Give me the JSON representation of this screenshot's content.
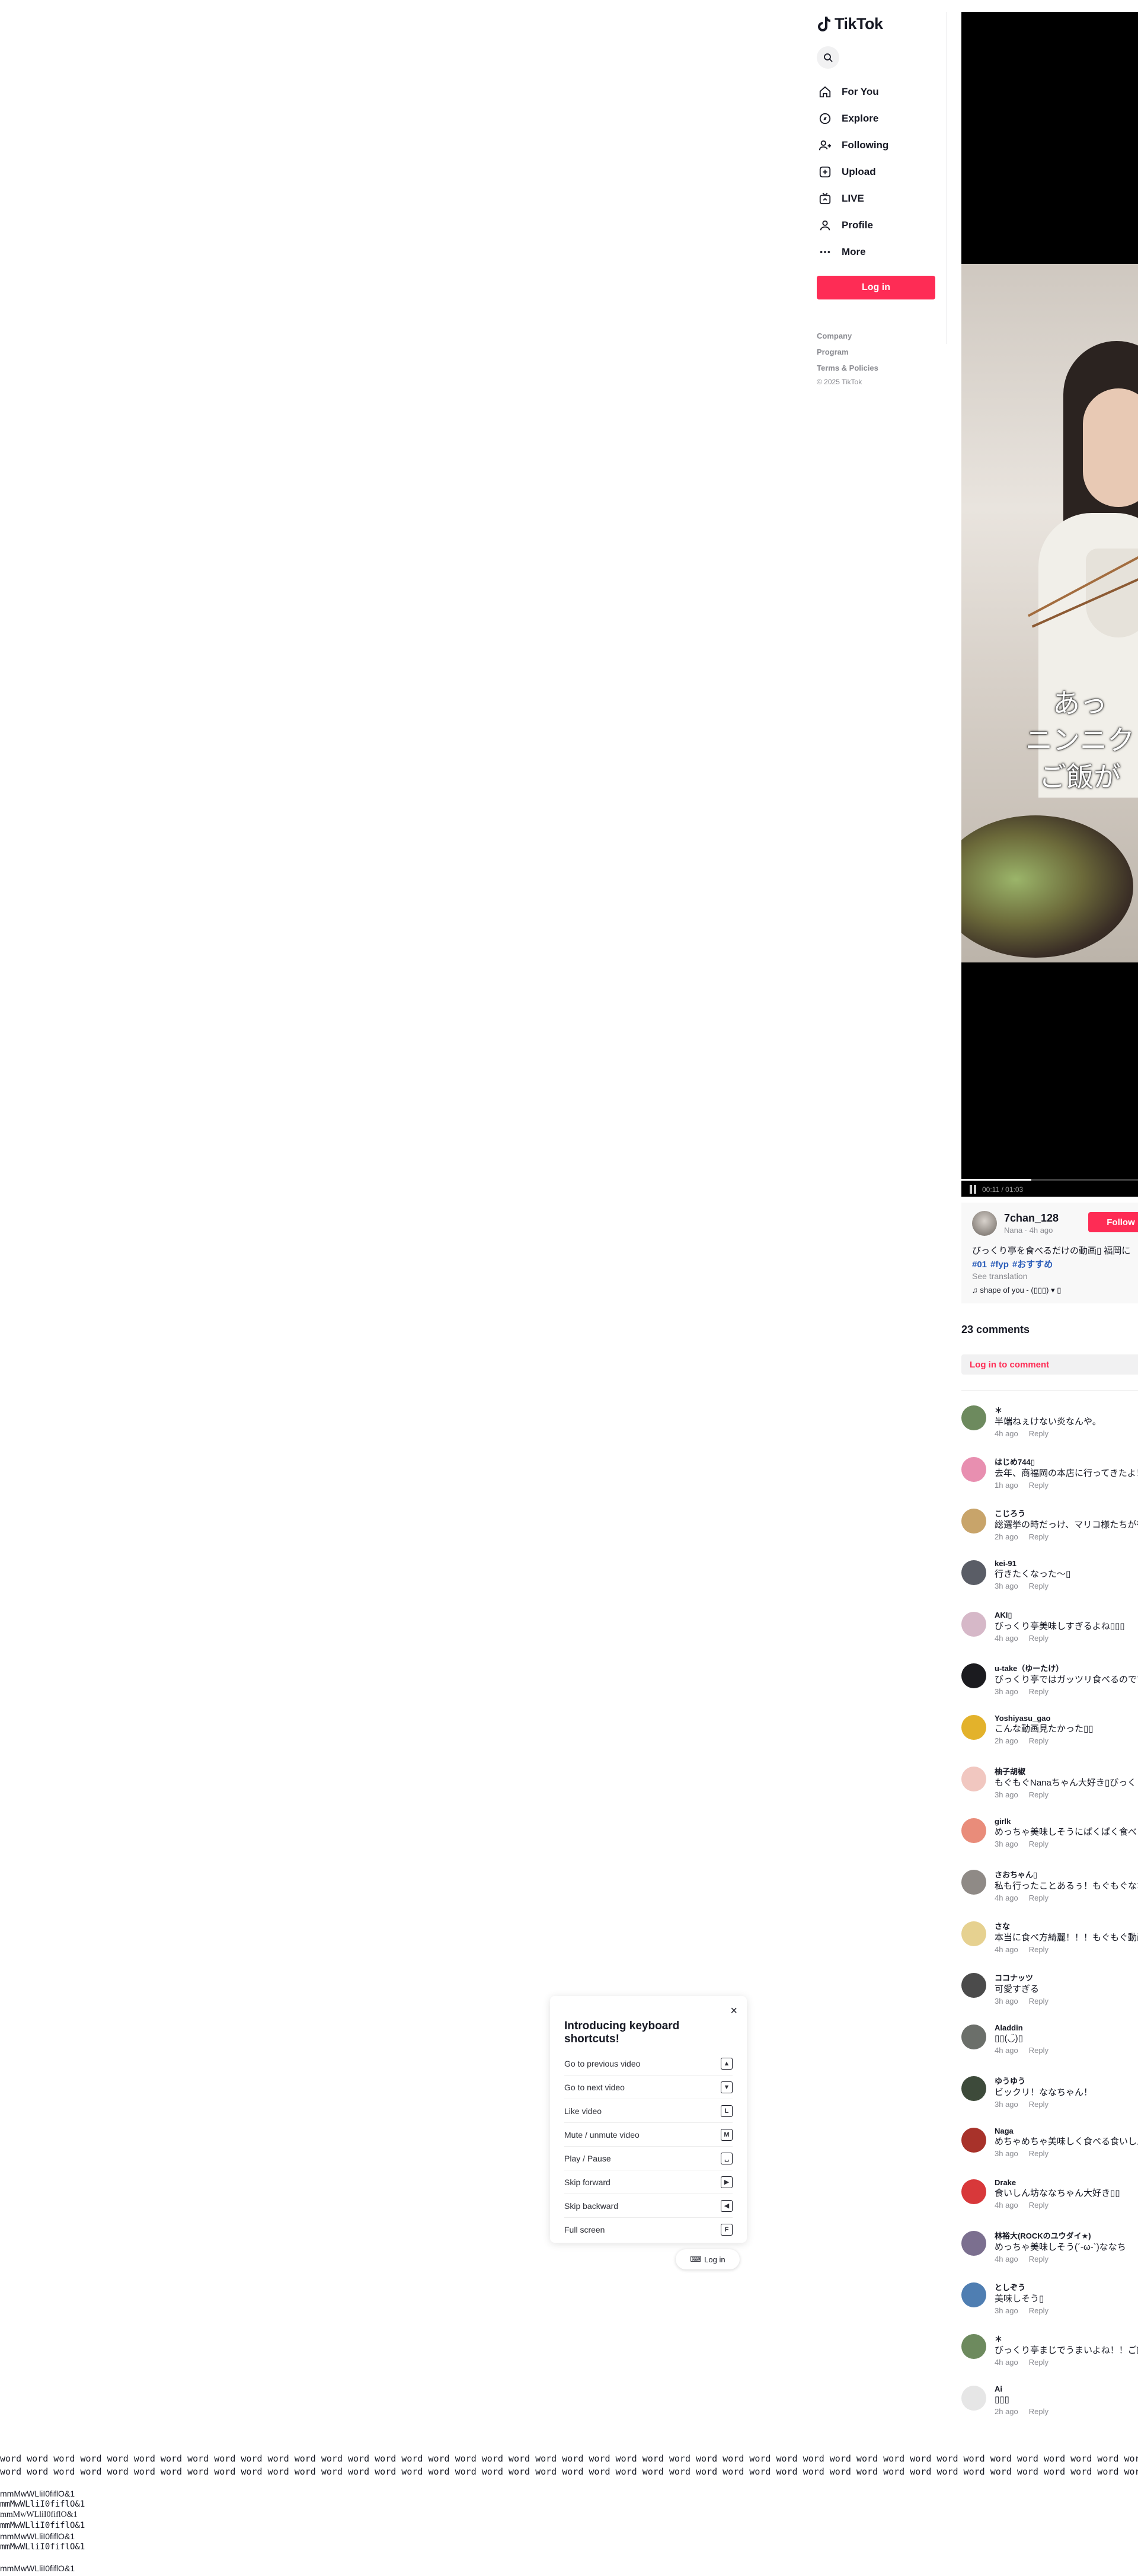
{
  "app": {
    "name": "TikTok"
  },
  "sidebar": {
    "items": [
      {
        "label": "For You",
        "icon": "home-icon"
      },
      {
        "label": "Explore",
        "icon": "compass-icon"
      },
      {
        "label": "Following",
        "icon": "following-icon"
      },
      {
        "label": "Upload",
        "icon": "upload-icon"
      },
      {
        "label": "LIVE",
        "icon": "live-icon"
      },
      {
        "label": "Profile",
        "icon": "profile-icon"
      },
      {
        "label": "More",
        "icon": "more-icon"
      }
    ],
    "login_label": "Log in",
    "footer": [
      "Company",
      "Program",
      "Terms & Policies"
    ],
    "copyright": "© 2025 TikTok"
  },
  "video": {
    "subtitle": [
      "あっ",
      "ニンニク",
      "ご飯が"
    ],
    "time": "00:11 / 01:03",
    "progress": 0.38
  },
  "post": {
    "username": "7chan_128",
    "meta": "Nana · 4h ago",
    "follow_label": "Follow",
    "description": "びっくり亭を食べるだけの動画▯ 福岡に",
    "tags": [
      "#01",
      "#fyp",
      "#おすすめ"
    ],
    "see_translation": "See translation",
    "music": "♫ shape of you - (▯▯▯) ▾ ▯"
  },
  "comments_header": {
    "count_label": "23 comments",
    "login_prompt": "Log in to comment"
  },
  "comments": [
    {
      "user": "＊",
      "text": "半端ねぇけない炎なんや。",
      "time": "4h ago",
      "reply": "Reply",
      "color": "#6d8a5e"
    },
    {
      "user": "はじめ744▯",
      "text": "去年、商福岡の本店に行ってきたよ！",
      "time": "1h ago",
      "reply": "Reply",
      "color": "#e88fb0"
    },
    {
      "user": "こじろう",
      "text": "総選挙の時だっけ、マリコ様たちが行っ",
      "time": "2h ago",
      "reply": "Reply",
      "color": "#c8a46a"
    },
    {
      "user": "kei-91",
      "text": "行きたくなった〜▯",
      "time": "3h ago",
      "reply": "Reply",
      "color": "#5a5d66"
    },
    {
      "user": "AKI▯",
      "text": "びっくり亭美味しすぎるよね▯▯▯",
      "time": "4h ago",
      "reply": "Reply",
      "color": "#d6b8c8"
    },
    {
      "user": "u-take（ゆーたけ）",
      "text": "びっくり亭ではガッツリ食べるのですね",
      "time": "3h ago",
      "reply": "Reply",
      "color": "#1b1b1f"
    },
    {
      "user": "Yoshiyasu_gao",
      "text": "こんな動画見たかった▯▯",
      "time": "2h ago",
      "reply": "Reply",
      "color": "#e3b22b"
    },
    {
      "user": "柚子胡椒",
      "text": "もぐもぐNanaちゃん大好き▯びっくり亭",
      "time": "3h ago",
      "reply": "Reply",
      "color": "#f1c7c0"
    },
    {
      "user": "girlk",
      "text": "めっちゃ美味しそうにぱくぱく食べとる",
      "time": "3h ago",
      "reply": "Reply",
      "color": "#e98c7a"
    },
    {
      "user": "さおちゃん▯",
      "text": "私も行ったことあるぅ！もぐもぐなな",
      "time": "4h ago",
      "reply": "Reply",
      "color": "#8f8a86"
    },
    {
      "user": "さな",
      "text": "本当に食べ方綺麗！！！もぐもぐ動画",
      "time": "4h ago",
      "reply": "Reply",
      "color": "#e6d190"
    },
    {
      "user": "ココナッツ",
      "text": "可愛すぎる",
      "time": "3h ago",
      "reply": "Reply",
      "color": "#4b4b4b"
    },
    {
      "user": "Aladdin",
      "text": "▯▯(◡̈)▯",
      "time": "4h ago",
      "reply": "Reply",
      "color": "#6b6f6a"
    },
    {
      "user": "ゆうゆう",
      "text": "ビックリ！ななちゃん！",
      "time": "3h ago",
      "reply": "Reply",
      "color": "#3d4a3a"
    },
    {
      "user": "Naga",
      "text": "めちゃめちゃ美味しく食べる食いしん坊",
      "time": "3h ago",
      "reply": "Reply",
      "color": "#a8322a"
    },
    {
      "user": "Drake",
      "text": "食いしん坊ななちゃん大好き▯▯",
      "time": "4h ago",
      "reply": "Reply",
      "color": "#d8383a"
    },
    {
      "user": "林裕大(ROCKのユウダイ★)",
      "text": "めっちゃ美味しそう(´-ω-`)ななち",
      "time": "4h ago",
      "reply": "Reply",
      "color": "#7b6f8f"
    },
    {
      "user": "としぞう",
      "text": "美味しそう▯",
      "time": "3h ago",
      "reply": "Reply",
      "color": "#4f7eb2"
    },
    {
      "user": "＊",
      "text": "びっくり亭まじでうまいよね！！ご飯",
      "time": "4h ago",
      "reply": "Reply",
      "color": "#6d8a5e"
    },
    {
      "user": "Ai",
      "text": "▯▯▯",
      "time": "2h ago",
      "reply": "Reply",
      "color": "#e6e6e6"
    }
  ],
  "keyboard_shortcuts": {
    "title": "Introducing keyboard shortcuts!",
    "close": "×",
    "rows": [
      {
        "label": "Go to previous video",
        "key": "▲"
      },
      {
        "label": "Go to next video",
        "key": "▼"
      },
      {
        "label": "Like video",
        "key": "L"
      },
      {
        "label": "Mute / unmute video",
        "key": "M"
      },
      {
        "label": "Play / Pause",
        "key": "␣"
      },
      {
        "label": "Skip forward",
        "key": "▶"
      },
      {
        "label": "Skip backward",
        "key": "◀"
      },
      {
        "label": "Full screen",
        "key": "F"
      }
    ],
    "mini_login": "Log in"
  },
  "footer_text": {
    "word_line": "word word word word word word word word word word word word word word word word word word word word word word word word word word word word word word word word word word word word word word word word word word word word word word word word word word word word word word word word word word word word word word word word word word word word word word word word word word word word word word word word word word word word word word word word word word word word word word",
    "glyph_lines": [
      "mmMwWLliI0fiflO&1",
      "mmMwWLliI0fiflO&1",
      "mmMwWLliI0fiflO&1",
      "mmMwWLliI0fiflO&1",
      "mmMwWLliI0fiflO&1",
      "mmMwWLliI0fiflO&1",
      "mmMwWLliI0fiflO&1"
    ]
  }
}
